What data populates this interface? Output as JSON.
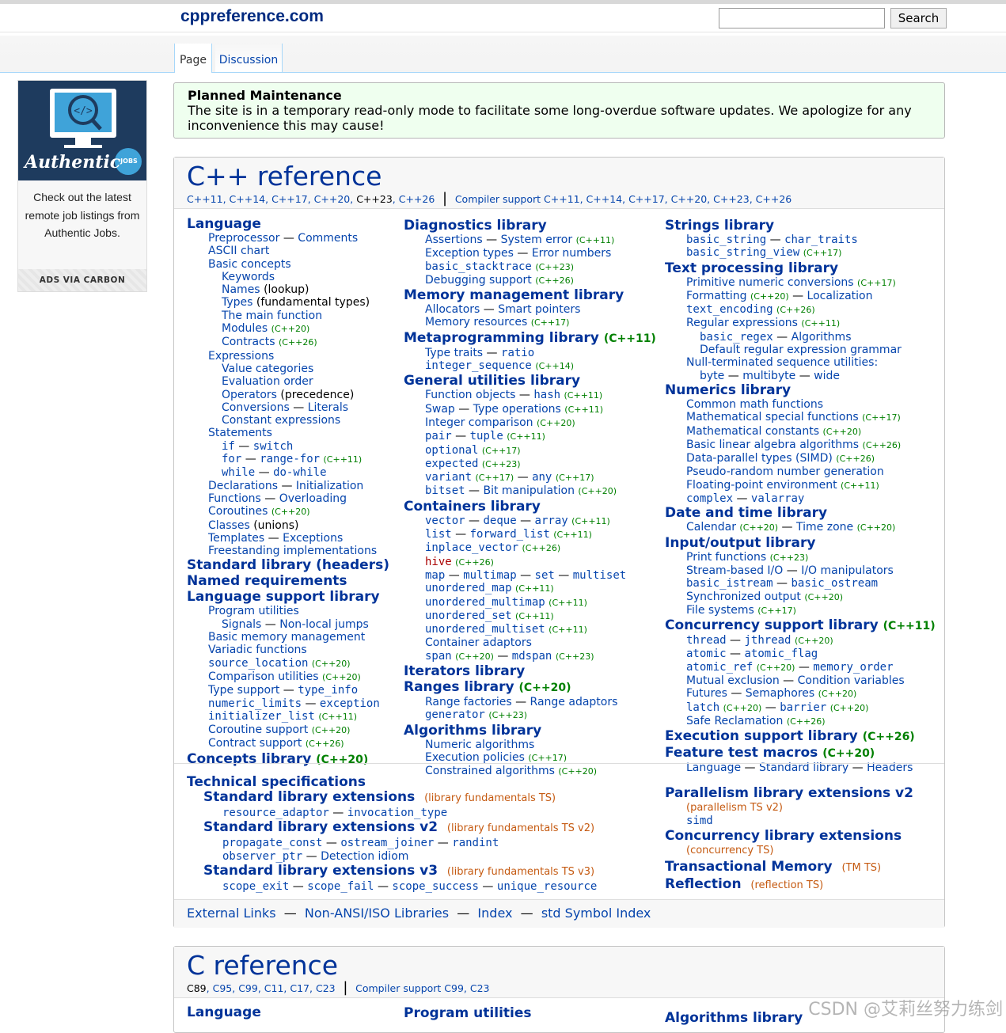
{
  "header": {
    "site_title": "cppreference.com",
    "search_button": "Search",
    "search_value": "",
    "tab_page": "Page",
    "tab_discussion": "Discussion"
  },
  "ad": {
    "brand": "Authentic",
    "badge": "JOBS",
    "text": "Check out the latest remote job listings from Authentic Jobs.",
    "footer": "ADS VIA CARBON"
  },
  "notice": {
    "title": "Planned Maintenance",
    "body": "The site is in a temporary read-only mode to facilitate some long-overdue software updates. We apologize for any inconvenience this may cause!"
  },
  "cpp": {
    "title": "C++ reference",
    "versions": [
      "C++11",
      "C++14",
      "C++17",
      "C++20",
      "C++23",
      "C++26"
    ],
    "compiler_support": "Compiler support C++11, C++14, C++17, C++20, C++23, C++26"
  },
  "col1": [
    {
      "t": "h",
      "a": "Language"
    },
    {
      "t": "i1",
      "a": "Preprocessor",
      "b": "Comments"
    },
    {
      "t": "i1",
      "a": "ASCII chart"
    },
    {
      "t": "i1",
      "a": "Basic concepts"
    },
    {
      "t": "i2",
      "a": "Keywords"
    },
    {
      "t": "i2",
      "a": "Names",
      "p": "(lookup)"
    },
    {
      "t": "i2",
      "a": "Types",
      "p": "(fundamental types)"
    },
    {
      "t": "i2",
      "a": "The main function"
    },
    {
      "t": "i2",
      "a": "Modules",
      "v": "(C++20)"
    },
    {
      "t": "i2",
      "a": "Contracts",
      "v": "(C++26)"
    },
    {
      "t": "i1",
      "a": "Expressions"
    },
    {
      "t": "i2",
      "a": "Value categories"
    },
    {
      "t": "i2",
      "a": "Evaluation order"
    },
    {
      "t": "i2",
      "a": "Operators",
      "p": "(precedence)"
    },
    {
      "t": "i2",
      "a": "Conversions",
      "b": "Literals"
    },
    {
      "t": "i2",
      "a": "Constant expressions"
    },
    {
      "t": "i1",
      "a": "Statements"
    },
    {
      "t": "i2",
      "a": "if",
      "b": "switch",
      "mono": true
    },
    {
      "t": "i2",
      "a": "for",
      "b": "range-for",
      "v": "(C++11)",
      "mono": true
    },
    {
      "t": "i2",
      "a": "while",
      "b": "do-while",
      "mono": true
    },
    {
      "t": "i1",
      "a": "Declarations",
      "b": "Initialization"
    },
    {
      "t": "i1",
      "a": "Functions",
      "b": "Overloading"
    },
    {
      "t": "i1",
      "a": "Coroutines",
      "v": "(C++20)"
    },
    {
      "t": "i1",
      "a": "Classes",
      "p": "(unions)"
    },
    {
      "t": "i1",
      "a": "Templates",
      "b": "Exceptions"
    },
    {
      "t": "i1",
      "a": "Freestanding implementations"
    },
    {
      "t": "h",
      "a": "Standard library",
      "p": "(headers)"
    },
    {
      "t": "h",
      "a": "Named requirements"
    },
    {
      "t": "h",
      "a": "Language support library"
    },
    {
      "t": "i1",
      "a": "Program utilities"
    },
    {
      "t": "i2",
      "a": "Signals",
      "b": "Non-local jumps"
    },
    {
      "t": "i1",
      "a": "Basic memory management"
    },
    {
      "t": "i1",
      "a": "Variadic functions"
    },
    {
      "t": "i1",
      "a": "source_location",
      "v": "(C++20)",
      "mono": true
    },
    {
      "t": "i1",
      "a": "Comparison utilities",
      "v": "(C++20)"
    },
    {
      "t": "i1",
      "a": "Type support",
      "b": "type_info",
      "monob": true
    },
    {
      "t": "i1",
      "a": "numeric_limits",
      "b": "exception",
      "mono": true
    },
    {
      "t": "i1",
      "a": "initializer_list",
      "v": "(C++11)",
      "mono": true
    },
    {
      "t": "i1",
      "a": "Coroutine support",
      "v": "(C++20)"
    },
    {
      "t": "i1",
      "a": "Contract support",
      "v": "(C++26)"
    },
    {
      "t": "h",
      "a": "Concepts library",
      "v": "(C++20)"
    }
  ],
  "col2": [
    {
      "t": "h",
      "a": "Diagnostics library"
    },
    {
      "t": "i1",
      "a": "Assertions",
      "b": "System error",
      "v": "(C++11)"
    },
    {
      "t": "i1",
      "a": "Exception types",
      "b": "Error numbers"
    },
    {
      "t": "i1",
      "a": "basic_stacktrace",
      "v": "(C++23)",
      "mono": true
    },
    {
      "t": "i1",
      "a": "Debugging support",
      "v": "(C++26)"
    },
    {
      "t": "h",
      "a": "Memory management library"
    },
    {
      "t": "i1",
      "a": "Allocators",
      "b": "Smart pointers"
    },
    {
      "t": "i1",
      "a": "Memory resources",
      "v": "(C++17)"
    },
    {
      "t": "h",
      "a": "Metaprogramming library",
      "v": "(C++11)"
    },
    {
      "t": "i1",
      "a": "Type traits",
      "b": "ratio",
      "monob": true
    },
    {
      "t": "i1",
      "a": "integer_sequence",
      "v": "(C++14)",
      "mono": true
    },
    {
      "t": "h",
      "a": "General utilities library"
    },
    {
      "t": "i1",
      "a": "Function objects",
      "b": "hash",
      "v": "(C++11)",
      "monob": true
    },
    {
      "t": "i1",
      "a": "Swap",
      "b": "Type operations",
      "v": "(C++11)"
    },
    {
      "t": "i1",
      "a": "Integer comparison",
      "v": "(C++20)"
    },
    {
      "t": "i1",
      "a": "pair",
      "b": "tuple",
      "v": "(C++11)",
      "mono": true
    },
    {
      "t": "i1",
      "a": "optional",
      "v": "(C++17)",
      "mono": true
    },
    {
      "t": "i1",
      "a": "expected",
      "v": "(C++23)",
      "mono": true
    },
    {
      "t": "i1",
      "a": "variant",
      "v": "(C++17)",
      "b": "any",
      "v2": "(C++17)",
      "mono": true
    },
    {
      "t": "i1",
      "a": "bitset",
      "b": "Bit manipulation",
      "v": "(C++20)",
      "monoa": true
    },
    {
      "t": "h",
      "a": "Containers library"
    },
    {
      "t": "i1",
      "a": "vector",
      "b": "deque",
      "c": "array",
      "v": "(C++11)",
      "mono": true
    },
    {
      "t": "i1",
      "a": "list",
      "b": "forward_list",
      "v": "(C++11)",
      "mono": true
    },
    {
      "t": "i1",
      "a": "inplace_vector",
      "v": "(C++26)",
      "mono": true
    },
    {
      "t": "i1",
      "a": "hive",
      "v": "(C++26)",
      "mono": true,
      "red": true
    },
    {
      "t": "i1",
      "a": "map",
      "b": "multimap",
      "c": "set",
      "d": "multiset",
      "mono": true
    },
    {
      "t": "i1",
      "a": "unordered_map",
      "v": "(C++11)",
      "mono": true
    },
    {
      "t": "i1",
      "a": "unordered_multimap",
      "v": "(C++11)",
      "mono": true
    },
    {
      "t": "i1",
      "a": "unordered_set",
      "v": "(C++11)",
      "mono": true
    },
    {
      "t": "i1",
      "a": "unordered_multiset",
      "v": "(C++11)",
      "mono": true
    },
    {
      "t": "i1",
      "a": "Container adaptors"
    },
    {
      "t": "i1",
      "a": "span",
      "v": "(C++20)",
      "b": "mdspan",
      "v2": "(C++23)",
      "mono": true
    },
    {
      "t": "h",
      "a": "Iterators library"
    },
    {
      "t": "h",
      "a": "Ranges library",
      "v": "(C++20)"
    },
    {
      "t": "i1",
      "a": "Range factories",
      "b": "Range adaptors"
    },
    {
      "t": "i1",
      "a": "generator",
      "v": "(C++23)",
      "mono": true
    },
    {
      "t": "h",
      "a": "Algorithms library"
    },
    {
      "t": "i1",
      "a": "Numeric algorithms"
    },
    {
      "t": "i1",
      "a": "Execution policies",
      "v": "(C++17)"
    },
    {
      "t": "i1",
      "a": "Constrained algorithms",
      "v": "(C++20)"
    }
  ],
  "col3": [
    {
      "t": "h",
      "a": "Strings library"
    },
    {
      "t": "i1",
      "a": "basic_string",
      "b": "char_traits",
      "mono": true
    },
    {
      "t": "i1",
      "a": "basic_string_view",
      "v": "(C++17)",
      "mono": true
    },
    {
      "t": "h",
      "a": "Text processing library"
    },
    {
      "t": "i1",
      "a": "Primitive numeric conversions",
      "v": "(C++17)"
    },
    {
      "t": "i1",
      "a": "Formatting",
      "v": "(C++20)",
      "b": "Localization"
    },
    {
      "t": "i1",
      "a": "text_encoding",
      "v": "(C++26)",
      "mono": true
    },
    {
      "t": "i1",
      "a": "Regular expressions",
      "v": "(C++11)"
    },
    {
      "t": "i2",
      "a": "basic_regex",
      "b": "Algorithms",
      "monoa": true
    },
    {
      "t": "i2",
      "a": "Default regular expression grammar"
    },
    {
      "t": "i1",
      "a": "Null-terminated sequence utilities:"
    },
    {
      "t": "i2",
      "a": "byte",
      "b": "multibyte",
      "c": "wide"
    },
    {
      "t": "h",
      "a": "Numerics library"
    },
    {
      "t": "i1",
      "a": "Common math functions"
    },
    {
      "t": "i1",
      "a": "Mathematical special functions",
      "v": "(C++17)"
    },
    {
      "t": "i1",
      "a": "Mathematical constants",
      "v": "(C++20)"
    },
    {
      "t": "i1",
      "a": "Basic linear algebra algorithms",
      "v": "(C++26)"
    },
    {
      "t": "i1",
      "a": "Data-parallel types (SIMD)",
      "v": "(C++26)"
    },
    {
      "t": "i1",
      "a": "Pseudo-random number generation"
    },
    {
      "t": "i1",
      "a": "Floating-point environment",
      "v": "(C++11)"
    },
    {
      "t": "i1",
      "a": "complex",
      "b": "valarray",
      "mono": true
    },
    {
      "t": "h",
      "a": "Date and time library"
    },
    {
      "t": "i1",
      "a": "Calendar",
      "v": "(C++20)",
      "b": "Time zone",
      "v2": "(C++20)"
    },
    {
      "t": "h",
      "a": "Input/output library"
    },
    {
      "t": "i1",
      "a": "Print functions",
      "v": "(C++23)"
    },
    {
      "t": "i1",
      "a": "Stream-based I/O",
      "b": "I/O manipulators"
    },
    {
      "t": "i1",
      "a": "basic_istream",
      "b": "basic_ostream",
      "mono": true
    },
    {
      "t": "i1",
      "a": "Synchronized output",
      "v": "(C++20)"
    },
    {
      "t": "i1",
      "a": "File systems",
      "v": "(C++17)"
    },
    {
      "t": "h",
      "a": "Concurrency support library",
      "v": "(C++11)"
    },
    {
      "t": "i1",
      "a": "thread",
      "b": "jthread",
      "v": "(C++20)",
      "mono": true
    },
    {
      "t": "i1",
      "a": "atomic",
      "b": "atomic_flag",
      "mono": true
    },
    {
      "t": "i1",
      "a": "atomic_ref",
      "v": "(C++20)",
      "b": "memory_order",
      "mono": true
    },
    {
      "t": "i1",
      "a": "Mutual exclusion",
      "b": "Condition variables"
    },
    {
      "t": "i1",
      "a": "Futures",
      "b": "Semaphores",
      "v": "(C++20)"
    },
    {
      "t": "i1",
      "a": "latch",
      "v": "(C++20)",
      "b": "barrier",
      "v2": "(C++20)",
      "mono": true
    },
    {
      "t": "i1",
      "a": "Safe Reclamation",
      "v": "(C++26)"
    },
    {
      "t": "h",
      "a": "Execution support library",
      "v": "(C++26)"
    },
    {
      "t": "h",
      "a": "Feature test macros",
      "v": "(C++20)"
    },
    {
      "t": "i1",
      "a": "Language",
      "b": "Standard library",
      "c": "Headers"
    }
  ],
  "tech": {
    "title": "Technical specifications",
    "left": [
      {
        "t": "sub",
        "a": "Standard library extensions",
        "ts": "(library fundamentals TS)"
      },
      {
        "t": "i2",
        "a": "resource_adaptor",
        "b": "invocation_type",
        "mono": true
      },
      {
        "t": "sub",
        "a": "Standard library extensions v2",
        "ts": "(library fundamentals TS v2)"
      },
      {
        "t": "i2",
        "a": "propagate_const",
        "b": "ostream_joiner",
        "c": "randint",
        "mono": true
      },
      {
        "t": "i2",
        "a": "observer_ptr",
        "b": "Detection idiom",
        "monoa": true
      },
      {
        "t": "sub",
        "a": "Standard library extensions v3",
        "ts": "(library fundamentals TS v3)"
      },
      {
        "t": "i2",
        "a": "scope_exit",
        "b": "scope_fail",
        "c": "scope_success",
        "d": "unique_resource",
        "mono": true
      }
    ],
    "right": [
      {
        "t": "h",
        "a": "Parallelism library extensions v2"
      },
      {
        "t": "tsl",
        "ts": "(parallelism TS v2)"
      },
      {
        "t": "i1",
        "a": "simd",
        "mono": true
      },
      {
        "t": "h",
        "a": "Concurrency library extensions"
      },
      {
        "t": "tsl",
        "ts": "(concurrency TS)"
      },
      {
        "t": "h",
        "a": "Transactional Memory",
        "ts": "(TM TS)"
      },
      {
        "t": "h",
        "a": "Reflection",
        "ts": "(reflection TS)"
      }
    ]
  },
  "links": [
    "External Links",
    "Non-ANSI/ISO Libraries",
    "Index",
    "std Symbol Index"
  ],
  "c_ref": {
    "title": "C reference",
    "versions": [
      "C89",
      "C95",
      "C99",
      "C11",
      "C17",
      "C23"
    ],
    "compiler_support": "Compiler support C99, C23",
    "col1_head": "Language",
    "col2_head": "Program utilities",
    "col3_head": "Algorithms library"
  },
  "watermark": "CSDN @艾莉丝努力练剑"
}
